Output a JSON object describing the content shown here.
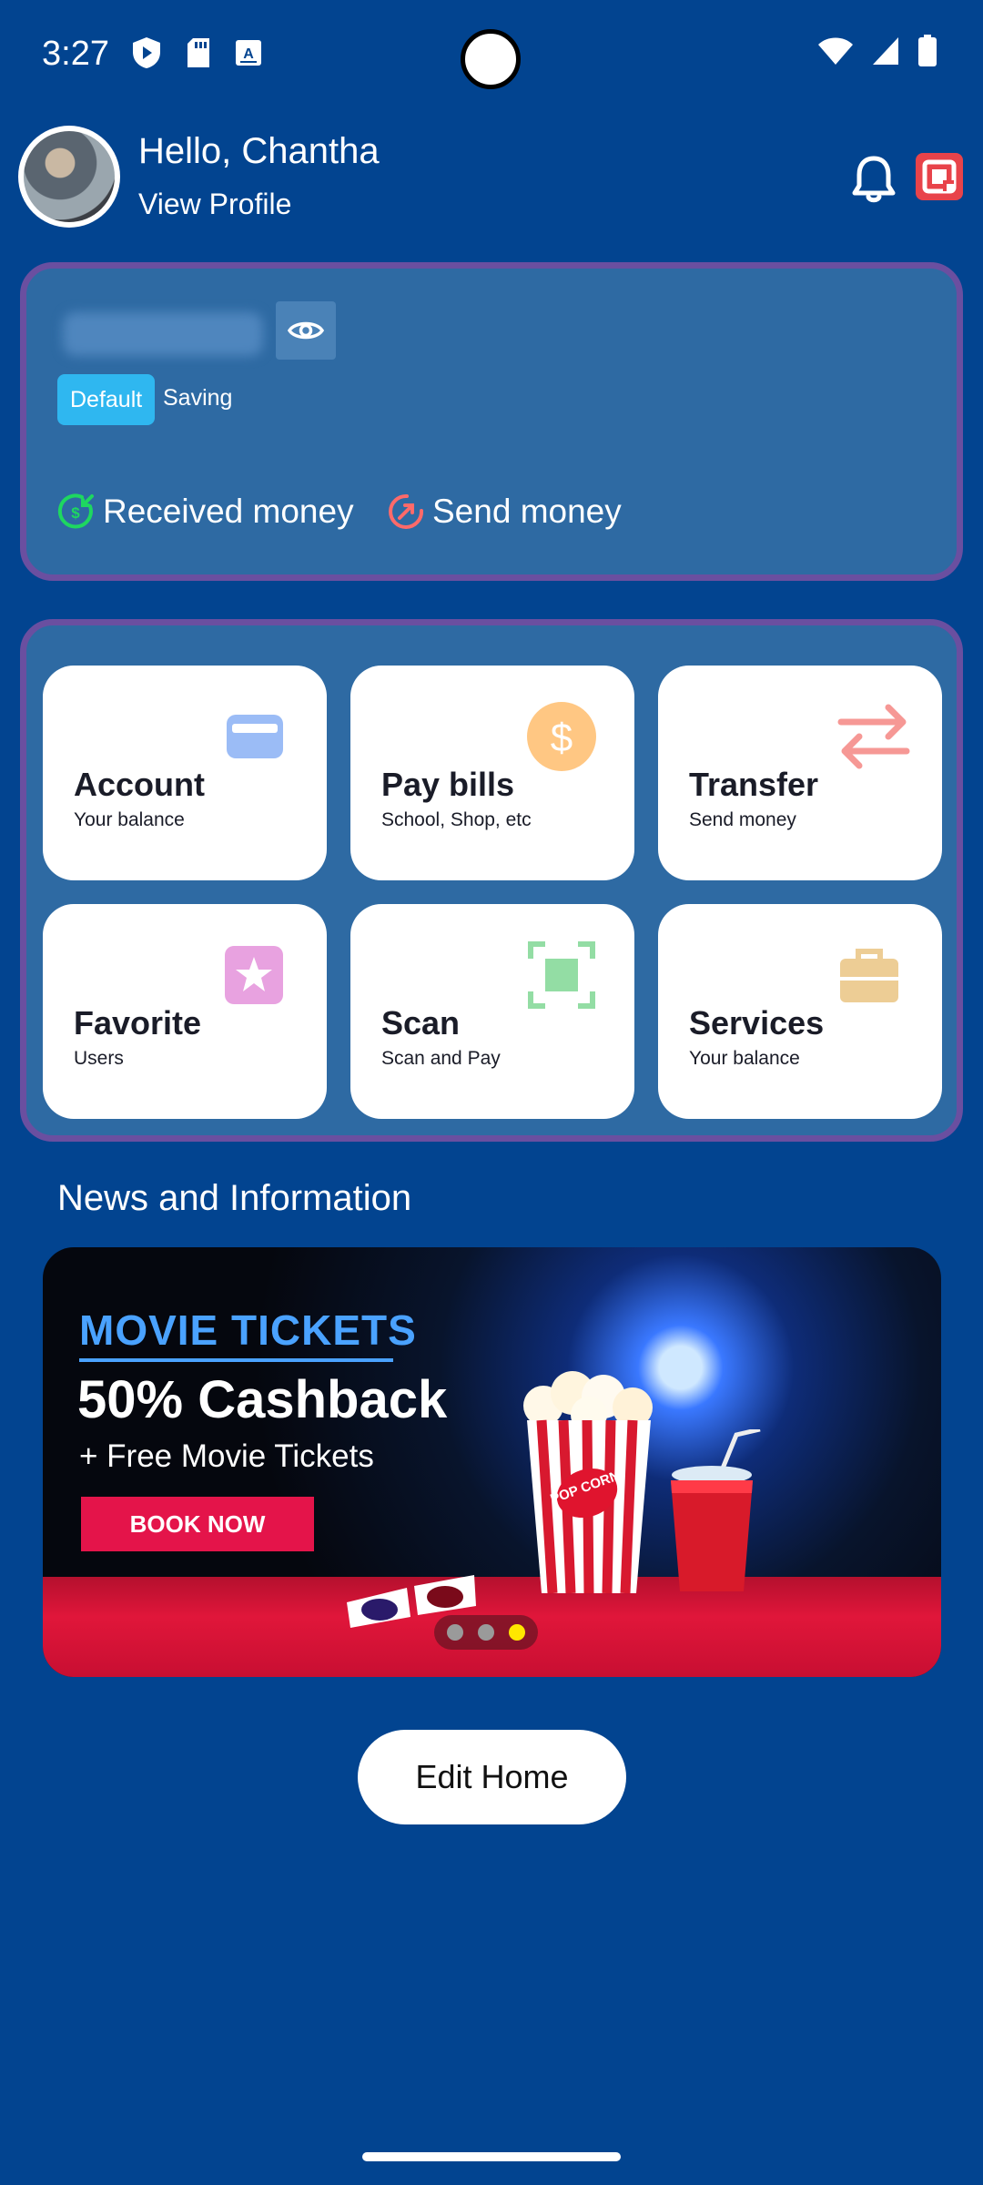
{
  "status_bar": {
    "time": "3:27",
    "left_icons": [
      "shield-play-icon",
      "sd-card-icon",
      "keyboard-a-icon"
    ],
    "right_icons": [
      "wifi-icon",
      "signal-icon",
      "battery-icon"
    ]
  },
  "header": {
    "greeting": "Hello, Chantha",
    "view_profile": "View Profile",
    "icons": [
      "bell-icon",
      "qr-scan-icon"
    ]
  },
  "balance_card": {
    "badge": "Default",
    "account_type": "Saving",
    "received_label": "Received money",
    "send_label": "Send money"
  },
  "services": [
    {
      "title": "Account",
      "subtitle": "Your balance",
      "icon": "wallet-icon",
      "color": "#4a86f0"
    },
    {
      "title": "Pay bills",
      "subtitle": "School, Shop, etc",
      "icon": "dollar-coin-icon",
      "color": "#ff9a1f"
    },
    {
      "title": "Transfer",
      "subtitle": "Send money",
      "icon": "transfer-arrows-icon",
      "color": "#f0443f"
    },
    {
      "title": "Favorite",
      "subtitle": "Users",
      "icon": "star-icon",
      "color": "#d657c8"
    },
    {
      "title": "Scan",
      "subtitle": "Scan and Pay",
      "icon": "scan-icon",
      "color": "#3cc35a"
    },
    {
      "title": "Services",
      "subtitle": "Your balance",
      "icon": "toolbox-icon",
      "color": "#e0a640"
    }
  ],
  "news": {
    "title": "News and Information",
    "banner": {
      "kicker": "MOVIE TICKETS",
      "headline": "50% Cashback",
      "subline": "+ Free Movie Tickets",
      "cta": "BOOK NOW",
      "popcorn_text": "POP CORN",
      "active_slide": 3,
      "slide_count": 3
    }
  },
  "edit_home_label": "Edit Home",
  "colors": {
    "background": "#024490",
    "card": "#2e6aa3",
    "card_border": "#6a4fa0",
    "accent_badge": "#2fb7f0"
  }
}
